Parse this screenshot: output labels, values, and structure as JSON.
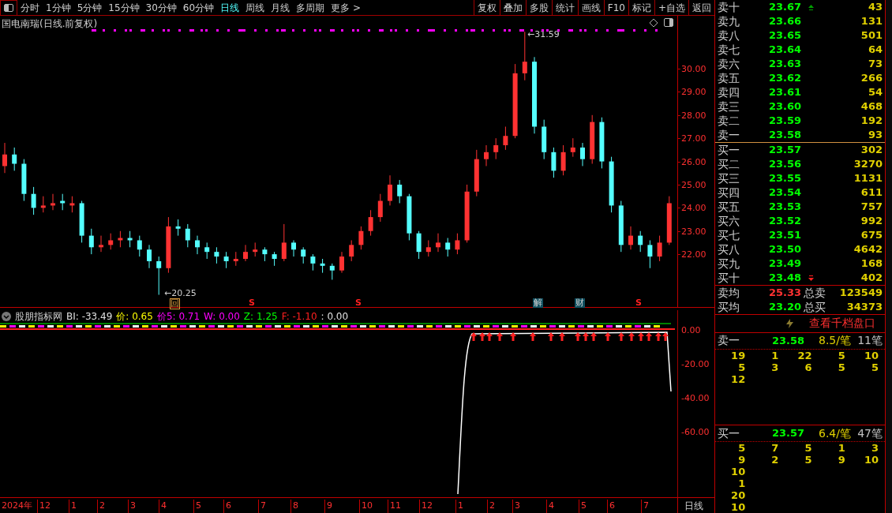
{
  "toolbar": {
    "periods": [
      {
        "label": "分时",
        "selected": false
      },
      {
        "label": "1分钟",
        "selected": false
      },
      {
        "label": "5分钟",
        "selected": false
      },
      {
        "label": "15分钟",
        "selected": false
      },
      {
        "label": "30分钟",
        "selected": false
      },
      {
        "label": "60分钟",
        "selected": false
      },
      {
        "label": "日线",
        "selected": true
      },
      {
        "label": "周线",
        "selected": false
      },
      {
        "label": "月线",
        "selected": false
      },
      {
        "label": "多周期",
        "selected": false
      },
      {
        "label": "更多 >",
        "selected": false
      }
    ],
    "actions": [
      "复权",
      "叠加",
      "多股",
      "统计",
      "画线",
      "F10",
      "标记",
      "+自选",
      "返回"
    ]
  },
  "price_chart": {
    "title": "国电南瑞(日线.前复权)",
    "high_label": "←31.59",
    "low_label": "←20.25",
    "chart_data": {
      "type": "candlestick",
      "ylim": [
        19.69,
        32.28
      ],
      "yticks": [
        {
          "value": 30,
          "label": "30.00"
        },
        {
          "value": 29,
          "label": "29.00"
        },
        {
          "value": 28,
          "label": "28.00"
        },
        {
          "value": 27,
          "label": "27.00"
        },
        {
          "value": 26,
          "label": "26.00"
        },
        {
          "value": 25,
          "label": "25.00"
        },
        {
          "value": 24,
          "label": "24.00"
        },
        {
          "value": 23,
          "label": "23.00"
        },
        {
          "value": 22,
          "label": "22.00"
        }
      ],
      "ohlc": [
        [
          25.8,
          26.8,
          25.5,
          26.3
        ],
        [
          26.3,
          26.6,
          25.6,
          25.9
        ],
        [
          25.9,
          26.1,
          24.3,
          24.6
        ],
        [
          24.6,
          24.9,
          23.7,
          24.0
        ],
        [
          24.0,
          24.5,
          23.8,
          24.1
        ],
        [
          24.1,
          24.6,
          23.9,
          24.2
        ],
        [
          24.3,
          24.6,
          23.9,
          24.2
        ],
        [
          24.1,
          24.5,
          23.8,
          24.2
        ],
        [
          24.2,
          24.3,
          22.5,
          22.8
        ],
        [
          22.8,
          23.1,
          22.0,
          22.3
        ],
        [
          22.3,
          22.8,
          22.1,
          22.4
        ],
        [
          22.4,
          22.9,
          22.2,
          22.6
        ],
        [
          22.6,
          23.0,
          22.3,
          22.7
        ],
        [
          22.7,
          23.0,
          22.3,
          22.6
        ],
        [
          22.6,
          22.8,
          21.9,
          22.2
        ],
        [
          22.2,
          22.4,
          21.4,
          21.7
        ],
        [
          21.7,
          21.9,
          20.25,
          21.4
        ],
        [
          21.4,
          23.6,
          21.2,
          23.2
        ],
        [
          23.2,
          23.5,
          22.8,
          23.1
        ],
        [
          23.1,
          23.3,
          22.3,
          22.6
        ],
        [
          22.6,
          22.8,
          22.0,
          22.3
        ],
        [
          22.3,
          22.5,
          21.8,
          22.1
        ],
        [
          22.1,
          22.3,
          21.6,
          21.9
        ],
        [
          21.9,
          22.1,
          21.4,
          21.7
        ],
        [
          21.7,
          22.1,
          21.5,
          21.8
        ],
        [
          21.8,
          22.4,
          21.7,
          22.1
        ],
        [
          22.1,
          22.5,
          21.9,
          22.2
        ],
        [
          22.2,
          22.3,
          21.7,
          22.0
        ],
        [
          22.0,
          22.1,
          21.5,
          21.8
        ],
        [
          21.8,
          23.3,
          21.7,
          22.5
        ],
        [
          22.5,
          22.6,
          21.9,
          22.2
        ],
        [
          22.2,
          22.3,
          21.6,
          21.9
        ],
        [
          21.9,
          22.0,
          21.3,
          21.6
        ],
        [
          21.6,
          21.8,
          21.2,
          21.5
        ],
        [
          21.5,
          21.6,
          20.9,
          21.3
        ],
        [
          21.3,
          22.1,
          21.2,
          21.9
        ],
        [
          21.9,
          22.6,
          21.7,
          22.4
        ],
        [
          22.4,
          23.2,
          22.2,
          23.0
        ],
        [
          23.0,
          23.9,
          22.8,
          23.6
        ],
        [
          23.6,
          24.6,
          23.4,
          24.3
        ],
        [
          24.3,
          25.4,
          24.1,
          25.0
        ],
        [
          25.0,
          25.2,
          24.2,
          24.5
        ],
        [
          24.5,
          24.6,
          22.6,
          22.9
        ],
        [
          22.9,
          23.0,
          21.8,
          22.1
        ],
        [
          22.1,
          22.6,
          21.9,
          22.3
        ],
        [
          22.3,
          22.9,
          22.1,
          22.5
        ],
        [
          22.5,
          22.7,
          21.9,
          22.2
        ],
        [
          22.2,
          22.9,
          22.0,
          22.6
        ],
        [
          22.6,
          25.0,
          22.5,
          24.7
        ],
        [
          24.7,
          26.5,
          24.5,
          26.1
        ],
        [
          26.1,
          26.7,
          25.8,
          26.4
        ],
        [
          26.4,
          27.0,
          26.1,
          26.7
        ],
        [
          26.7,
          27.5,
          26.5,
          27.1
        ],
        [
          27.1,
          30.2,
          27.0,
          29.8
        ],
        [
          29.8,
          31.59,
          29.5,
          30.3
        ],
        [
          30.3,
          30.5,
          27.2,
          27.5
        ],
        [
          27.5,
          27.8,
          26.1,
          26.4
        ],
        [
          26.4,
          26.6,
          25.3,
          25.6
        ],
        [
          25.6,
          26.7,
          25.4,
          26.4
        ],
        [
          26.4,
          27.0,
          26.2,
          26.6
        ],
        [
          26.6,
          26.8,
          25.8,
          26.1
        ],
        [
          26.1,
          28.0,
          25.9,
          27.7
        ],
        [
          27.7,
          27.9,
          25.7,
          26.0
        ],
        [
          26.0,
          26.2,
          23.8,
          24.1
        ],
        [
          24.1,
          24.3,
          22.1,
          22.4
        ],
        [
          22.4,
          23.2,
          22.2,
          22.8
        ],
        [
          22.8,
          23.0,
          22.1,
          22.4
        ],
        [
          22.4,
          22.6,
          21.4,
          21.9
        ],
        [
          21.9,
          22.8,
          21.7,
          22.5
        ],
        [
          22.5,
          24.5,
          22.4,
          24.2
        ]
      ]
    },
    "markers": [
      {
        "kind": "icon",
        "text": "回"
      },
      {
        "kind": "s",
        "text": "S"
      },
      {
        "kind": "s",
        "text": "S"
      },
      {
        "kind": "box",
        "text": "解"
      },
      {
        "kind": "box",
        "text": "财"
      },
      {
        "kind": "s",
        "text": "S"
      }
    ]
  },
  "indicator": {
    "name": "股朋指标网",
    "values": [
      {
        "text": "BI: -33.49",
        "color": "#e0e0e0"
      },
      {
        "text": "价: 0.65",
        "color": "#ffff00"
      },
      {
        "text": "价5: 0.71",
        "color": "#ff00ff"
      },
      {
        "text": "W: 0.00",
        "color": "#ff00ff"
      },
      {
        "text": "Z: 1.25",
        "color": "#00ff00"
      },
      {
        "text": "F: -1.10",
        "color": "#ff2020"
      },
      {
        "text": ": 0.00",
        "color": "#e0e0e0"
      }
    ],
    "y_ticks": [
      "0.00",
      "-20.00",
      "-40.00",
      "-60.00"
    ]
  },
  "date_axis": {
    "labels": [
      "2024年",
      "12",
      "1",
      "2",
      "3",
      "4",
      "5",
      "6",
      "7",
      "8",
      "9",
      "10",
      "11",
      "12",
      "1",
      "2",
      "3",
      "4",
      "5",
      "6",
      "7"
    ],
    "period": "日线"
  },
  "order_book": {
    "asks": [
      {
        "name": "卖十",
        "price": "23.67",
        "volume": "43"
      },
      {
        "name": "卖九",
        "price": "23.66",
        "volume": "131"
      },
      {
        "name": "卖八",
        "price": "23.65",
        "volume": "501"
      },
      {
        "name": "卖七",
        "price": "23.64",
        "volume": "64"
      },
      {
        "name": "卖六",
        "price": "23.63",
        "volume": "73"
      },
      {
        "name": "卖五",
        "price": "23.62",
        "volume": "266"
      },
      {
        "name": "卖四",
        "price": "23.61",
        "volume": "54"
      },
      {
        "name": "卖三",
        "price": "23.60",
        "volume": "468"
      },
      {
        "name": "卖二",
        "price": "23.59",
        "volume": "192"
      },
      {
        "name": "卖一",
        "price": "23.58",
        "volume": "93"
      }
    ],
    "bids": [
      {
        "name": "买一",
        "price": "23.57",
        "volume": "302"
      },
      {
        "name": "买二",
        "price": "23.56",
        "volume": "3270"
      },
      {
        "name": "买三",
        "price": "23.55",
        "volume": "1131"
      },
      {
        "name": "买四",
        "price": "23.54",
        "volume": "611"
      },
      {
        "name": "买五",
        "price": "23.53",
        "volume": "757"
      },
      {
        "name": "买六",
        "price": "23.52",
        "volume": "992"
      },
      {
        "name": "买七",
        "price": "23.51",
        "volume": "675"
      },
      {
        "name": "买八",
        "price": "23.50",
        "volume": "4642"
      },
      {
        "name": "买九",
        "price": "23.49",
        "volume": "168"
      },
      {
        "name": "买十",
        "price": "23.48",
        "volume": "402"
      }
    ],
    "summary": [
      {
        "label": "卖均",
        "price": "25.33",
        "kind": "up",
        "total_label": "总卖",
        "total": "123549"
      },
      {
        "label": "买均",
        "price": "23.20",
        "kind": "down",
        "total_label": "总买",
        "total": "34373"
      }
    ]
  },
  "queue": {
    "link": "查看千档盘口",
    "sections": [
      {
        "label": "卖一",
        "price": "23.58",
        "average": "8.5/笔",
        "count": "11笔",
        "rows": [
          [
            "19",
            "1",
            "22",
            "5",
            "10"
          ],
          [
            "5",
            "3",
            "6",
            "5",
            "5"
          ],
          [
            "12"
          ]
        ]
      },
      {
        "label": "买一",
        "price": "23.57",
        "average": "6.4/笔",
        "count": "47笔",
        "rows": [
          [
            "5",
            "7",
            "5",
            "1",
            "3"
          ],
          [
            "9",
            "2",
            "5",
            "9",
            "10"
          ],
          [
            "10"
          ],
          [
            "1"
          ],
          [
            "20"
          ],
          [
            "10"
          ]
        ]
      }
    ]
  }
}
